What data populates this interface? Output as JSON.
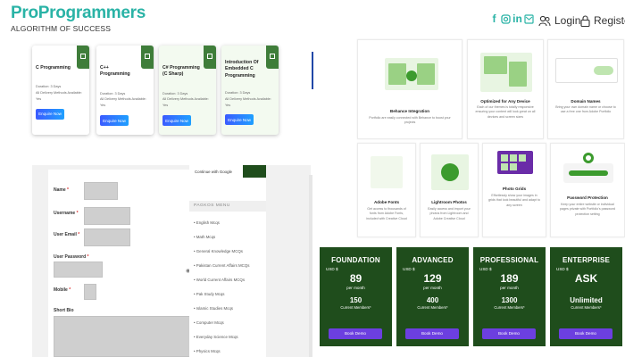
{
  "header": {
    "logo_title": "ProProgrammers",
    "logo_subtitle": "ALGORITHM OF SUCCESS",
    "social_icons": [
      "facebook-icon",
      "instagram-icon",
      "linkedin-icon",
      "mail-icon"
    ],
    "login_label": "Login",
    "register_label": "Register",
    "brand_color": "#2ab3a6"
  },
  "courses": [
    {
      "title": "C Programming",
      "duration": "Duration: 3 Days",
      "delivery": "All Delivery Methods Available: Yes",
      "button": "Enquire Now"
    },
    {
      "title": "C++ Programming",
      "duration": "Duration: 3 Days",
      "delivery": "All Delivery Methods Available: Yes",
      "button": "Enquire Now"
    },
    {
      "title": "C# Programming (C Sharp)",
      "duration": "Duration: 3 Days",
      "delivery": "All Delivery Methods Available: Yes",
      "button": "Enquire Now"
    },
    {
      "title": "Introduction Of Embedded C Programming",
      "duration": "Duration: 3 Days",
      "delivery": "All Delivery Methods Available: Yes",
      "button": "Enquire Now"
    }
  ],
  "features": [
    {
      "title": "Behance Integration",
      "desc": "Portfolio are easily connected with Behance to boost your projects"
    },
    {
      "title": "Optimized for Any Device",
      "desc": "Each of our themes is totally responsive ensuring your content will look great on all devices and screen sizes"
    },
    {
      "title": "Domain Names",
      "desc": "Bring your own domain name or choose to use a free one from Adobe Portfolio"
    },
    {
      "title": "Adobe Fonts",
      "desc": "Get access to thousands of fonts from Adobe Fonts, included with Creative Cloud"
    },
    {
      "title": "Lightroom Photos",
      "desc": "Easily access and import your photos from Lightroom and Adobe Creative Cloud"
    },
    {
      "title": "Photo Grids",
      "desc": "Effortlessly show your images in grids that look beautiful and adapt to any screen"
    },
    {
      "title": "Password Protection",
      "desc": "Keep your entire website or individual pages private with Portfolio's password protection setting"
    }
  ],
  "pricing": [
    {
      "name": "FOUNDATION",
      "currency": "USD $",
      "amount": "89",
      "period": "per month",
      "members": "150",
      "members_label": "Current Members*",
      "button": "Book Demo"
    },
    {
      "name": "ADVANCED",
      "currency": "USD $",
      "amount": "129",
      "period": "per month",
      "members": "400",
      "members_label": "Current Members*",
      "button": "Book Demo"
    },
    {
      "name": "PROFESSIONAL",
      "currency": "USD $",
      "amount": "189",
      "period": "per month",
      "members": "1300",
      "members_label": "Current Members*",
      "button": "Book Demo"
    },
    {
      "name": "ENTERPRISE",
      "currency": "USD $",
      "amount": "ASK",
      "period": "",
      "members": "Unlimited",
      "members_label": "Current Members*",
      "button": "Book Demo"
    }
  ],
  "form": {
    "name_label": "Name",
    "username_label": "Username",
    "email_label": "User Email",
    "password_label": "User Password",
    "mobile_label": "Mobile",
    "bio_label": "Short Bio",
    "required_mark": "*"
  },
  "sidemenu": {
    "signin_text": "Continue with Google",
    "heading": "PAGKOS MENU",
    "items": [
      "English Mcqs",
      "Math Mcqs",
      "General Knowledge MCQs",
      "Pakistan Current Affairs MCQs",
      "World Current Affairs MCQs",
      "Pak Study Mcqs",
      "Islamic Studies Mcqs",
      "Computer Mcqs",
      "Everyday Science Mcqs",
      "Physics Mcqs"
    ]
  },
  "colors": {
    "pricing_bg": "#1f4d1c",
    "pricing_button": "#6c3fe0",
    "enquire_button": "#3b5bff"
  }
}
